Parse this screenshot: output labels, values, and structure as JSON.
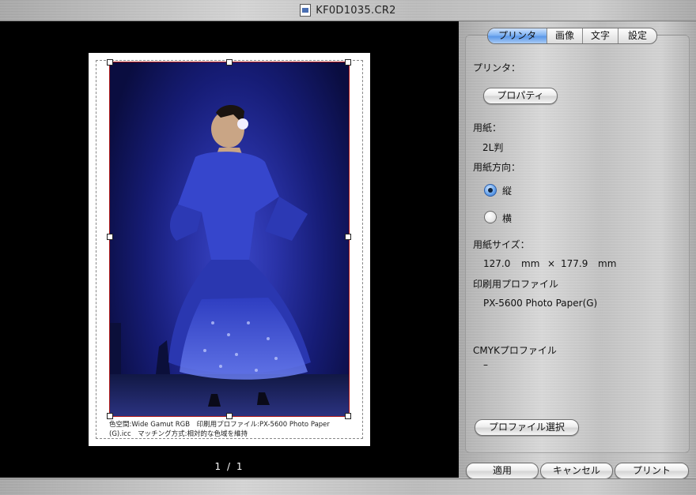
{
  "window": {
    "title": "KF0D1035.CR2"
  },
  "preview": {
    "caption_line1": "色空間:Wide Gamut RGB　印刷用プロファイル:PX-5600 Photo Paper",
    "caption_line2": "(G).icc　マッチング方式:相対的な色域を維持",
    "page_indicator": "1 / 1"
  },
  "tabs": [
    {
      "label": "プリンタ",
      "active": true
    },
    {
      "label": "画像",
      "active": false
    },
    {
      "label": "文字",
      "active": false
    },
    {
      "label": "設定",
      "active": false
    }
  ],
  "printer": {
    "label": "プリンタ：",
    "properties_button": "プロパティ"
  },
  "paper": {
    "label": "用紙：",
    "value": "2L判"
  },
  "orientation": {
    "label": "用紙方向：",
    "portrait": "縦",
    "landscape": "横",
    "selected": "portrait"
  },
  "paper_size": {
    "label": "用紙サイズ：",
    "width": "127.0",
    "height": "177.9",
    "unit": "mm",
    "times": "×"
  },
  "print_profile": {
    "label": "印刷用プロファイル",
    "value": "PX-5600 Photo Paper(G)"
  },
  "cmyk_profile": {
    "label": "CMYKプロファイル",
    "value": "–"
  },
  "buttons": {
    "select_profile": "プロファイル選択",
    "apply": "適用",
    "cancel": "キャンセル",
    "print": "プリント"
  },
  "colors": {
    "tab_active": "#6aa6ee",
    "crop_border": "#b01818",
    "photo_background": "#1e2690",
    "dress": "#3b4fd8"
  }
}
